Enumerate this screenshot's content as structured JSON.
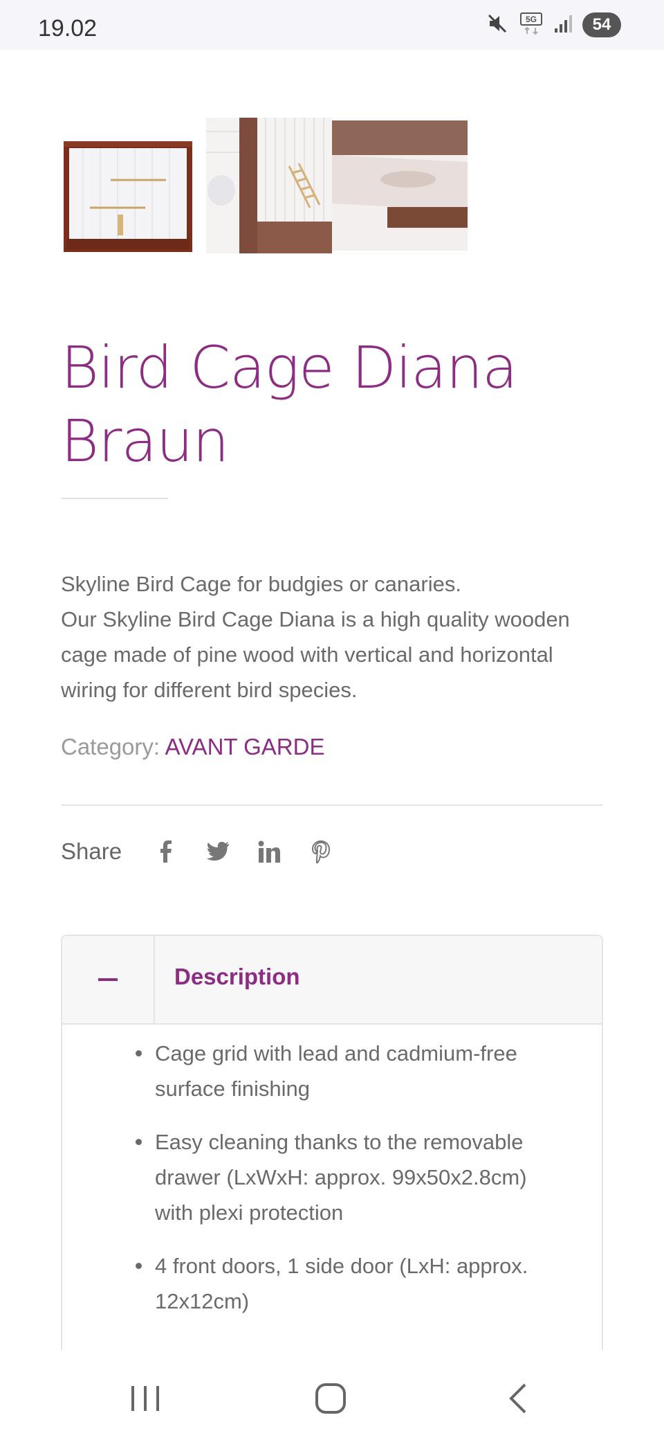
{
  "status_bar": {
    "time": "19.02",
    "network": "5G",
    "battery": "54",
    "icons": [
      "mute-icon",
      "5g-icon",
      "signal-icon",
      "battery-icon"
    ]
  },
  "gallery": {
    "thumbnails": [
      "bird-cage-front-thumbnail",
      "bird-cage-side-thumbnail",
      "bird-cage-drawer-thumbnail"
    ]
  },
  "product": {
    "title": "Bird Cage Diana Braun",
    "description_line1": "Skyline Bird Cage for budgies or canaries.",
    "description_line2": "Our Skyline Bird Cage Diana is a high quality wooden cage made of pine wood with vertical and horizontal wiring for different bird species.",
    "category_label": "Category:",
    "category_value": "AVANT GARDE"
  },
  "share": {
    "label": "Share",
    "networks": [
      "facebook",
      "twitter",
      "linkedin",
      "pinterest"
    ]
  },
  "accordion": {
    "toggle_symbol": "minus",
    "title": "Description",
    "items": [
      "Cage grid with lead and cadmium-free surface finishing",
      "Easy cleaning thanks to the removable drawer (LxWxH: approx. 99x50x2.8cm) with plexi protection",
      "4 front doors, 1 side door (LxH: approx. 12x12cm)"
    ]
  },
  "colors": {
    "accent": "#8c2c82",
    "text": "#6a6a6a",
    "muted": "#9a9a9a",
    "divider": "#e4e4e4",
    "statusbar_bg": "#f6f5fa"
  }
}
